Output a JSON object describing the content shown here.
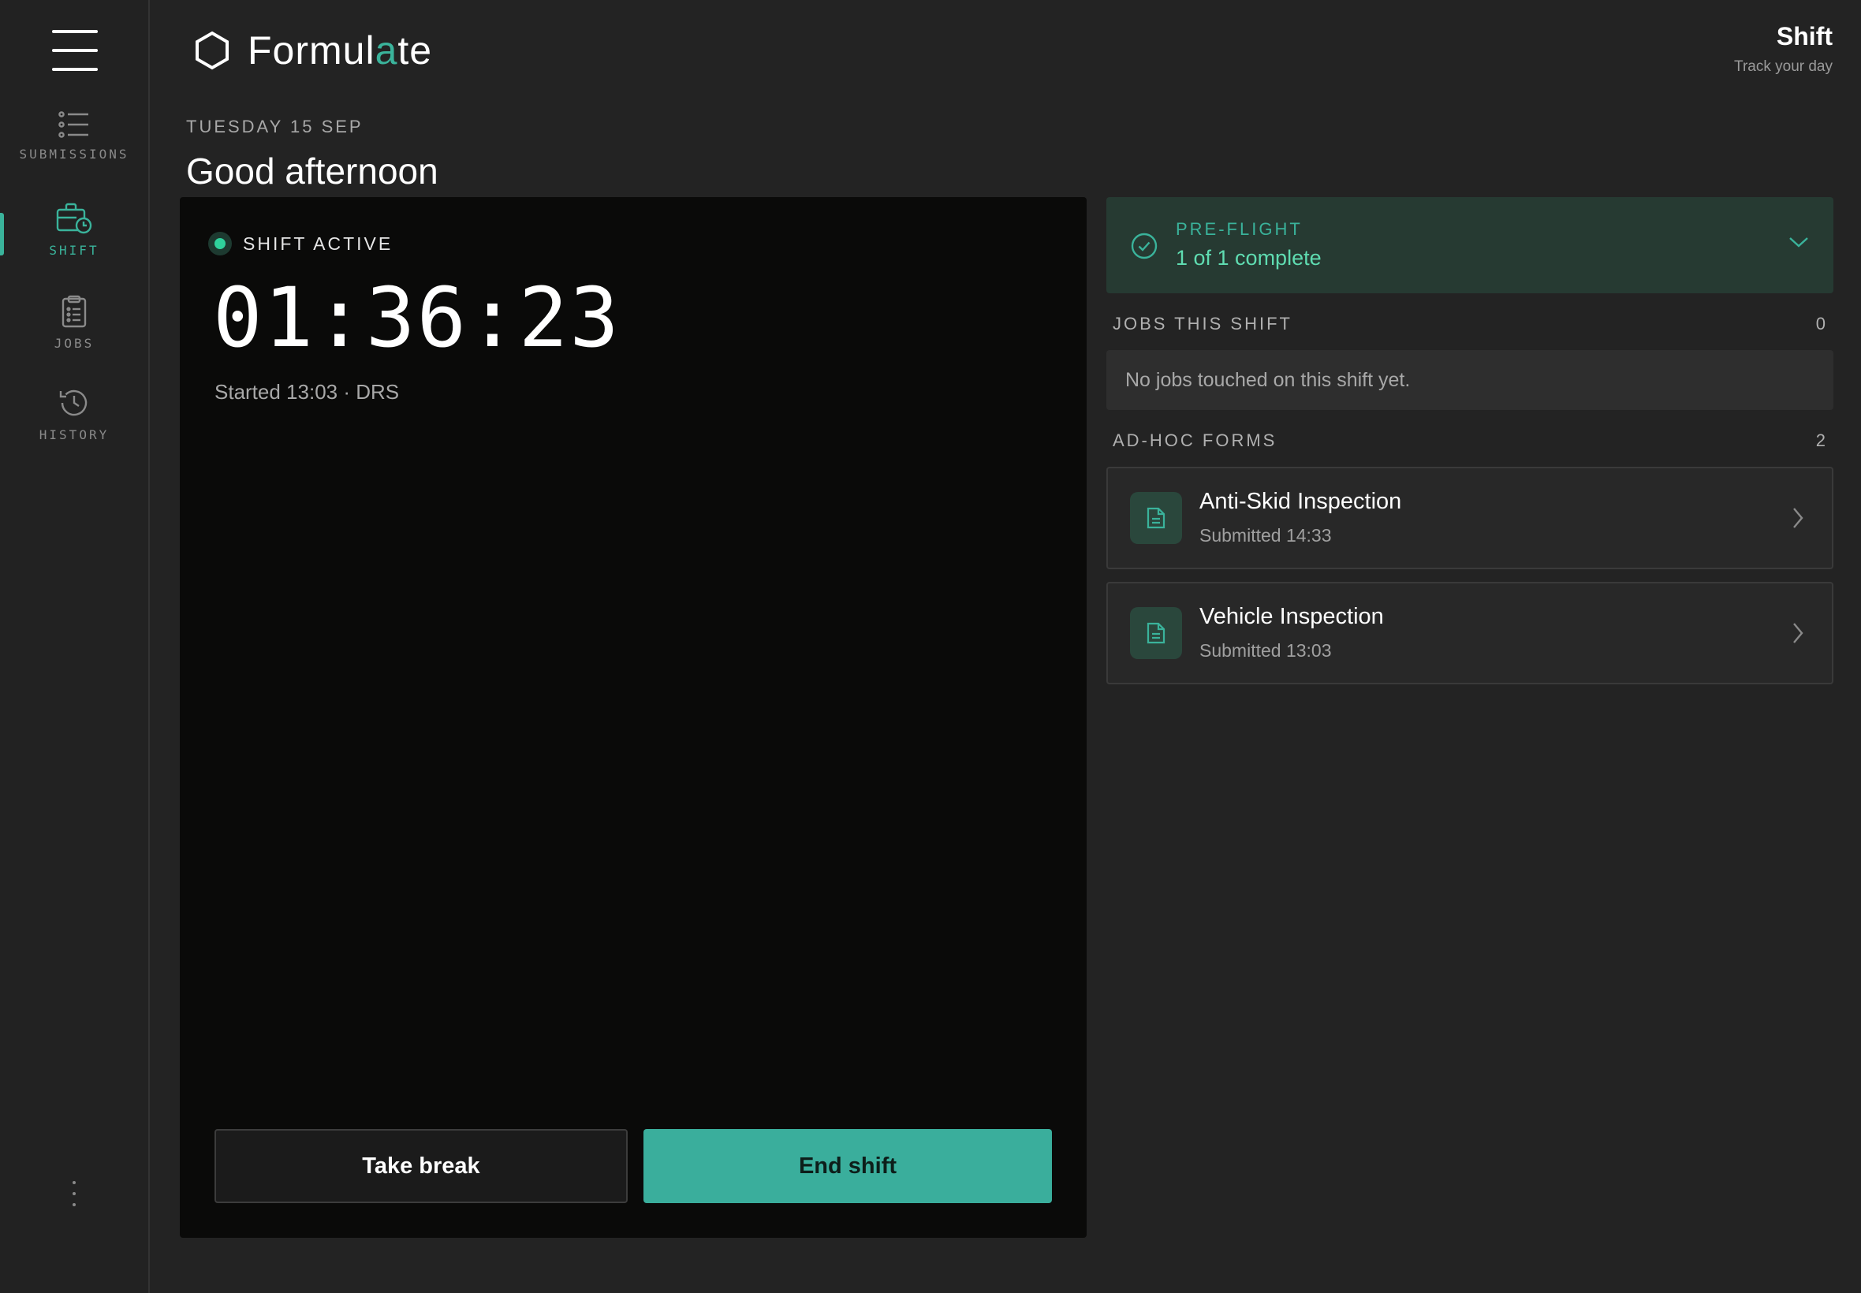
{
  "app": {
    "brand_prefix": "Formul",
    "brand_accent": "a",
    "brand_suffix": "te",
    "accent_color": "#3ab39b"
  },
  "sidebar": {
    "items": [
      {
        "label": "SUBMISSIONS",
        "icon": "list-icon",
        "active": false
      },
      {
        "label": "SHIFT",
        "icon": "briefcase-clock-icon",
        "active": true
      },
      {
        "label": "JOBS",
        "icon": "clipboard-icon",
        "active": false
      },
      {
        "label": "HISTORY",
        "icon": "history-icon",
        "active": false
      }
    ]
  },
  "header": {
    "title": "Shift",
    "subtitle": "Track your day"
  },
  "greeting": {
    "date": "TUESDAY 15 SEP",
    "message": "Good afternoon"
  },
  "shift": {
    "status": "SHIFT ACTIVE",
    "status_color": "#2fd19b",
    "timer": "01:36:23",
    "started": "Started 13:03 · DRS",
    "break_label": "Take break",
    "end_label": "End shift"
  },
  "preflight": {
    "label": "PRE-FLIGHT",
    "value": "1 of 1 complete"
  },
  "jobs": {
    "title": "JOBS THIS SHIFT",
    "count": "0",
    "empty_text": "No jobs touched on this shift yet."
  },
  "adhoc": {
    "title": "AD-HOC FORMS",
    "count": "2",
    "forms": [
      {
        "title": "Anti-Skid Inspection",
        "subtitle": "Submitted 14:33",
        "icon": "document-icon"
      },
      {
        "title": "Vehicle Inspection",
        "subtitle": "Submitted 13:03",
        "icon": "document-icon"
      }
    ]
  }
}
